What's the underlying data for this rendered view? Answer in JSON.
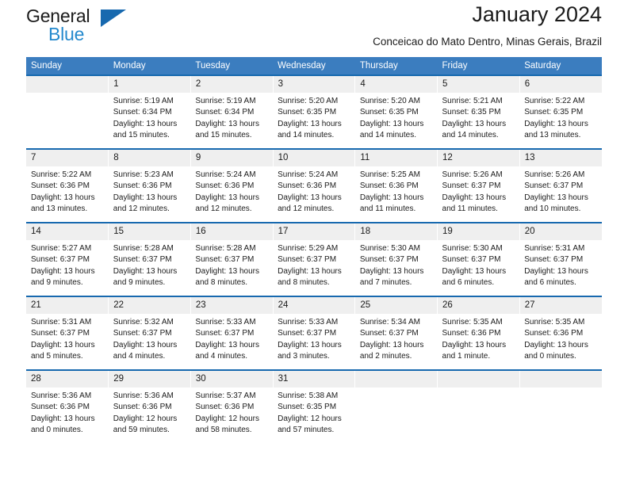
{
  "brand": {
    "name_top": "General",
    "name_bottom": "Blue",
    "triangle_icon": "triangle-icon"
  },
  "header": {
    "month_title": "January 2024",
    "location": "Conceicao do Mato Dentro, Minas Gerais, Brazil"
  },
  "colors": {
    "header_blue": "#3b7dbf",
    "rule_blue": "#1769af",
    "daynum_gray": "#efefef",
    "brand_blue": "#2489cd"
  },
  "weekdays": [
    "Sunday",
    "Monday",
    "Tuesday",
    "Wednesday",
    "Thursday",
    "Friday",
    "Saturday"
  ],
  "weeks": [
    [
      {
        "day": "",
        "empty": true
      },
      {
        "day": "1",
        "sunrise": "Sunrise: 5:19 AM",
        "sunset": "Sunset: 6:34 PM",
        "daylight": "Daylight: 13 hours and 15 minutes."
      },
      {
        "day": "2",
        "sunrise": "Sunrise: 5:19 AM",
        "sunset": "Sunset: 6:34 PM",
        "daylight": "Daylight: 13 hours and 15 minutes."
      },
      {
        "day": "3",
        "sunrise": "Sunrise: 5:20 AM",
        "sunset": "Sunset: 6:35 PM",
        "daylight": "Daylight: 13 hours and 14 minutes."
      },
      {
        "day": "4",
        "sunrise": "Sunrise: 5:20 AM",
        "sunset": "Sunset: 6:35 PM",
        "daylight": "Daylight: 13 hours and 14 minutes."
      },
      {
        "day": "5",
        "sunrise": "Sunrise: 5:21 AM",
        "sunset": "Sunset: 6:35 PM",
        "daylight": "Daylight: 13 hours and 14 minutes."
      },
      {
        "day": "6",
        "sunrise": "Sunrise: 5:22 AM",
        "sunset": "Sunset: 6:35 PM",
        "daylight": "Daylight: 13 hours and 13 minutes."
      }
    ],
    [
      {
        "day": "7",
        "sunrise": "Sunrise: 5:22 AM",
        "sunset": "Sunset: 6:36 PM",
        "daylight": "Daylight: 13 hours and 13 minutes."
      },
      {
        "day": "8",
        "sunrise": "Sunrise: 5:23 AM",
        "sunset": "Sunset: 6:36 PM",
        "daylight": "Daylight: 13 hours and 12 minutes."
      },
      {
        "day": "9",
        "sunrise": "Sunrise: 5:24 AM",
        "sunset": "Sunset: 6:36 PM",
        "daylight": "Daylight: 13 hours and 12 minutes."
      },
      {
        "day": "10",
        "sunrise": "Sunrise: 5:24 AM",
        "sunset": "Sunset: 6:36 PM",
        "daylight": "Daylight: 13 hours and 12 minutes."
      },
      {
        "day": "11",
        "sunrise": "Sunrise: 5:25 AM",
        "sunset": "Sunset: 6:36 PM",
        "daylight": "Daylight: 13 hours and 11 minutes."
      },
      {
        "day": "12",
        "sunrise": "Sunrise: 5:26 AM",
        "sunset": "Sunset: 6:37 PM",
        "daylight": "Daylight: 13 hours and 11 minutes."
      },
      {
        "day": "13",
        "sunrise": "Sunrise: 5:26 AM",
        "sunset": "Sunset: 6:37 PM",
        "daylight": "Daylight: 13 hours and 10 minutes."
      }
    ],
    [
      {
        "day": "14",
        "sunrise": "Sunrise: 5:27 AM",
        "sunset": "Sunset: 6:37 PM",
        "daylight": "Daylight: 13 hours and 9 minutes."
      },
      {
        "day": "15",
        "sunrise": "Sunrise: 5:28 AM",
        "sunset": "Sunset: 6:37 PM",
        "daylight": "Daylight: 13 hours and 9 minutes."
      },
      {
        "day": "16",
        "sunrise": "Sunrise: 5:28 AM",
        "sunset": "Sunset: 6:37 PM",
        "daylight": "Daylight: 13 hours and 8 minutes."
      },
      {
        "day": "17",
        "sunrise": "Sunrise: 5:29 AM",
        "sunset": "Sunset: 6:37 PM",
        "daylight": "Daylight: 13 hours and 8 minutes."
      },
      {
        "day": "18",
        "sunrise": "Sunrise: 5:30 AM",
        "sunset": "Sunset: 6:37 PM",
        "daylight": "Daylight: 13 hours and 7 minutes."
      },
      {
        "day": "19",
        "sunrise": "Sunrise: 5:30 AM",
        "sunset": "Sunset: 6:37 PM",
        "daylight": "Daylight: 13 hours and 6 minutes."
      },
      {
        "day": "20",
        "sunrise": "Sunrise: 5:31 AM",
        "sunset": "Sunset: 6:37 PM",
        "daylight": "Daylight: 13 hours and 6 minutes."
      }
    ],
    [
      {
        "day": "21",
        "sunrise": "Sunrise: 5:31 AM",
        "sunset": "Sunset: 6:37 PM",
        "daylight": "Daylight: 13 hours and 5 minutes."
      },
      {
        "day": "22",
        "sunrise": "Sunrise: 5:32 AM",
        "sunset": "Sunset: 6:37 PM",
        "daylight": "Daylight: 13 hours and 4 minutes."
      },
      {
        "day": "23",
        "sunrise": "Sunrise: 5:33 AM",
        "sunset": "Sunset: 6:37 PM",
        "daylight": "Daylight: 13 hours and 4 minutes."
      },
      {
        "day": "24",
        "sunrise": "Sunrise: 5:33 AM",
        "sunset": "Sunset: 6:37 PM",
        "daylight": "Daylight: 13 hours and 3 minutes."
      },
      {
        "day": "25",
        "sunrise": "Sunrise: 5:34 AM",
        "sunset": "Sunset: 6:37 PM",
        "daylight": "Daylight: 13 hours and 2 minutes."
      },
      {
        "day": "26",
        "sunrise": "Sunrise: 5:35 AM",
        "sunset": "Sunset: 6:36 PM",
        "daylight": "Daylight: 13 hours and 1 minute."
      },
      {
        "day": "27",
        "sunrise": "Sunrise: 5:35 AM",
        "sunset": "Sunset: 6:36 PM",
        "daylight": "Daylight: 13 hours and 0 minutes."
      }
    ],
    [
      {
        "day": "28",
        "sunrise": "Sunrise: 5:36 AM",
        "sunset": "Sunset: 6:36 PM",
        "daylight": "Daylight: 13 hours and 0 minutes."
      },
      {
        "day": "29",
        "sunrise": "Sunrise: 5:36 AM",
        "sunset": "Sunset: 6:36 PM",
        "daylight": "Daylight: 12 hours and 59 minutes."
      },
      {
        "day": "30",
        "sunrise": "Sunrise: 5:37 AM",
        "sunset": "Sunset: 6:36 PM",
        "daylight": "Daylight: 12 hours and 58 minutes."
      },
      {
        "day": "31",
        "sunrise": "Sunrise: 5:38 AM",
        "sunset": "Sunset: 6:35 PM",
        "daylight": "Daylight: 12 hours and 57 minutes."
      },
      {
        "day": "",
        "empty": true
      },
      {
        "day": "",
        "empty": true
      },
      {
        "day": "",
        "empty": true
      }
    ]
  ]
}
